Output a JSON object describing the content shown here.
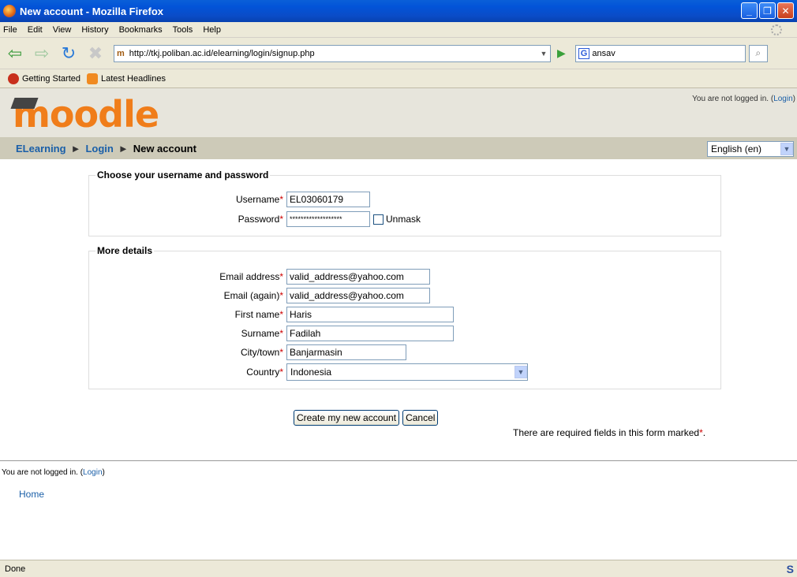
{
  "window": {
    "title": "New account - Mozilla Firefox"
  },
  "menu": [
    "File",
    "Edit",
    "View",
    "History",
    "Bookmarks",
    "Tools",
    "Help"
  ],
  "toolbar": {
    "url": "http://tkj.poliban.ac.id/elearning/login/signup.php",
    "search_value": "ansav"
  },
  "bookmarks": [
    "Getting Started",
    "Latest Headlines"
  ],
  "header": {
    "logo_text": "moodle",
    "login_prefix": "You are not logged in. (",
    "login_link": "Login",
    "login_suffix": ")"
  },
  "breadcrumb": {
    "site": "ELearning",
    "login": "Login",
    "current": "New account",
    "separator": "►"
  },
  "language": {
    "selected": "English (en)"
  },
  "form": {
    "section1": {
      "legend": "Choose your username and password",
      "username_label": "Username",
      "username_value": "EL03060179",
      "password_label": "Password",
      "password_value": "*******************",
      "unmask_label": "Unmask"
    },
    "section2": {
      "legend": "More details",
      "email_label": "Email address",
      "email_value": "valid_address@yahoo.com",
      "email2_label": "Email (again)",
      "email2_value": "valid_address@yahoo.com",
      "firstname_label": "First name",
      "firstname_value": "Haris",
      "surname_label": "Surname",
      "surname_value": "Fadilah",
      "city_label": "City/town",
      "city_value": "Banjarmasin",
      "country_label": "Country",
      "country_value": "Indonesia"
    },
    "required_marker": "*",
    "submit_label": "Create my new account",
    "cancel_label": "Cancel",
    "required_note": "There are required fields in this form marked",
    "required_note_end": "."
  },
  "footer": {
    "login_prefix": "You are not logged in. (",
    "login_link": "Login",
    "login_suffix": ")",
    "home_link": "Home"
  },
  "status": {
    "text": "Done"
  }
}
